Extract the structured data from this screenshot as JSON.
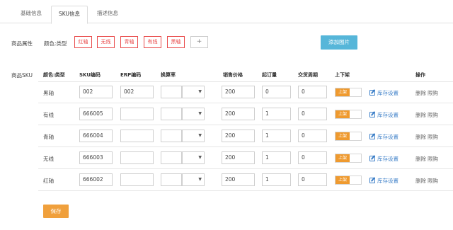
{
  "tabs": [
    {
      "label": "基础信息"
    },
    {
      "label": "SKU信息"
    },
    {
      "label": "描述信息"
    }
  ],
  "attributes": {
    "section_label": "商品属性",
    "color_label": "颜色:类型",
    "tags": [
      "红轴",
      "无线",
      "青轴",
      "有线",
      "黑轴"
    ],
    "add_tag_label": "+",
    "add_image_label": "添加图片"
  },
  "sku": {
    "section_label": "商品SKU",
    "headers": {
      "color": "颜色:类型",
      "code": "SKU编码",
      "erp": "ERP编码",
      "ratio": "换算率",
      "price": "销售价格",
      "moq": "起订量",
      "delivery": "交货周期",
      "shelf": "上下架",
      "ops": "操作"
    },
    "rows": [
      {
        "color": "黑轴",
        "code": "002",
        "erp": "002",
        "price": "200",
        "moq": "0",
        "delivery": "0",
        "shelf": "上架",
        "stock": "库存设置",
        "delete": "删除",
        "limit": "限购"
      },
      {
        "color": "有线",
        "code": "666005",
        "erp": "",
        "price": "200",
        "moq": "1",
        "delivery": "0",
        "shelf": "上架",
        "stock": "库存设置",
        "delete": "删除",
        "limit": "限购"
      },
      {
        "color": "青轴",
        "code": "666004",
        "erp": "",
        "price": "200",
        "moq": "1",
        "delivery": "0",
        "shelf": "上架",
        "stock": "库存设置",
        "delete": "删除",
        "limit": "限购"
      },
      {
        "color": "无线",
        "code": "666003",
        "erp": "",
        "price": "200",
        "moq": "1",
        "delivery": "0",
        "shelf": "上架",
        "stock": "库存设置",
        "delete": "删除",
        "limit": "限购"
      },
      {
        "color": "红轴",
        "code": "666002",
        "erp": "",
        "price": "200",
        "moq": "1",
        "delivery": "0",
        "shelf": "上架",
        "stock": "库存设置",
        "delete": "删除",
        "limit": "限购"
      }
    ]
  },
  "save_label": "保存",
  "colors": {
    "accent": "#f0a03c",
    "tag_border": "#e94b4b",
    "image_button": "#56b6d9",
    "link": "#3c7fc8"
  }
}
